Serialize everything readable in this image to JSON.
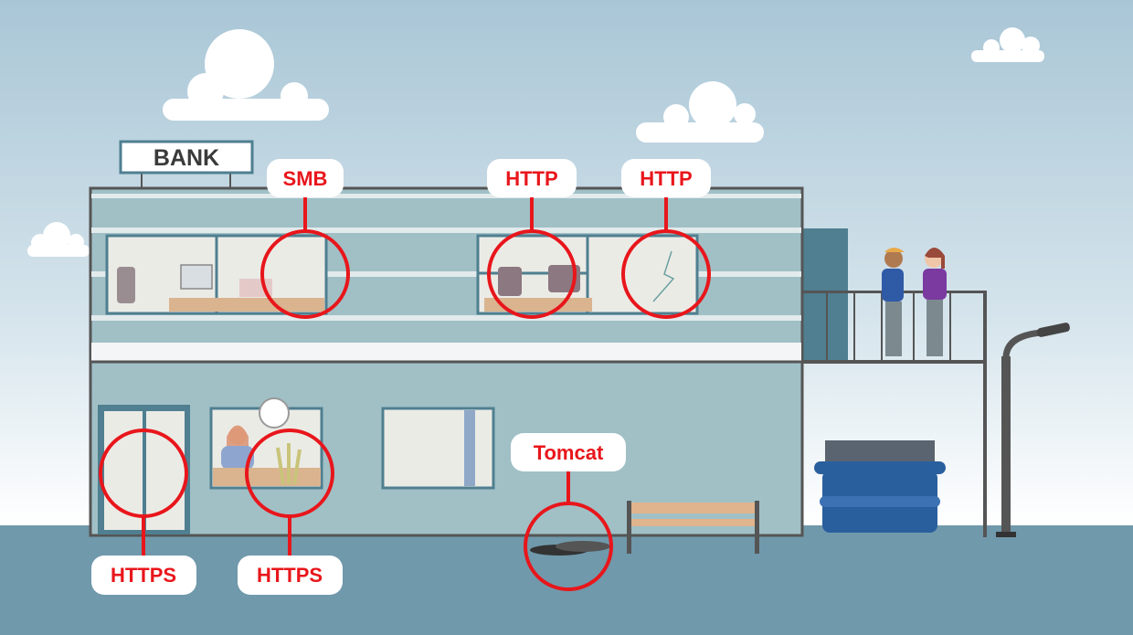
{
  "sign": {
    "text": "BANK"
  },
  "labels": [
    {
      "id": "smb",
      "text": "SMB"
    },
    {
      "id": "http-1",
      "text": "HTTP"
    },
    {
      "id": "http-2",
      "text": "HTTP"
    },
    {
      "id": "tomcat",
      "text": "Tomcat"
    },
    {
      "id": "https-door",
      "text": "HTTPS"
    },
    {
      "id": "https-window",
      "text": "HTTPS"
    }
  ],
  "colors": {
    "accent": "#e8161b",
    "sky_top": "#a9c6d6",
    "ground": "#7099ab",
    "facade": "#a0c0c6",
    "outline": "#555555"
  }
}
